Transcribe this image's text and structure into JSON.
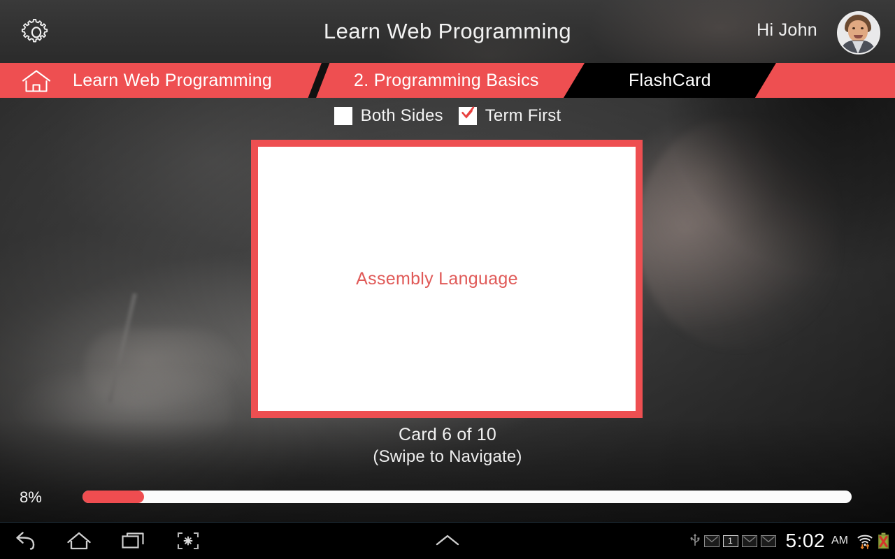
{
  "theme": {
    "accent_red": "#ee4f51",
    "card_term_red": "#e05a58",
    "active_crumb_bg": "#000000",
    "header_bg": "#333333",
    "progress_fill": "#ef4d50",
    "progress_track": "#fbfbfb"
  },
  "header": {
    "gear_icon": "gear-icon",
    "title": "Learn Web Programming",
    "greeting": "Hi John",
    "avatar_icon": "user-avatar-photo"
  },
  "breadcrumb": {
    "home_icon": "home-icon",
    "items": [
      {
        "label": "Learn Web Programming",
        "active": false
      },
      {
        "label": "2. Programming Basics",
        "active": false
      },
      {
        "label": "FlashCard",
        "active": true
      }
    ]
  },
  "options": [
    {
      "label": "Both Sides",
      "checked": false,
      "icon": "checkbox-unchecked-icon"
    },
    {
      "label": "Term First",
      "checked": true,
      "icon": "checkbox-checked-icon"
    }
  ],
  "flashcard": {
    "term": "Assembly Language",
    "count_label": "Card 6 of 10",
    "navigate_hint": "(Swipe to Navigate)",
    "current_index": 6,
    "total": 10
  },
  "progress": {
    "percent_label": "8%",
    "percent_value": 8
  },
  "system_bar": {
    "buttons": [
      {
        "name": "back-icon",
        "label": "Back"
      },
      {
        "name": "home-icon",
        "label": "Home"
      },
      {
        "name": "recent-apps-icon",
        "label": "Recent apps"
      },
      {
        "name": "screenshot-icon",
        "label": "Screenshot"
      }
    ],
    "caret_icon": "chevron-up-icon",
    "tray": {
      "usb_icon": "usb-icon",
      "mail_icons": [
        "mail-icon",
        "mail-badge-icon",
        "mail-icon",
        "mail-icon"
      ],
      "mail_badge_count": "1",
      "wifi_icon": "wifi-transfer-icon",
      "battery_icon": "battery-error-icon"
    },
    "clock": "5:02",
    "meridiem": "AM"
  }
}
